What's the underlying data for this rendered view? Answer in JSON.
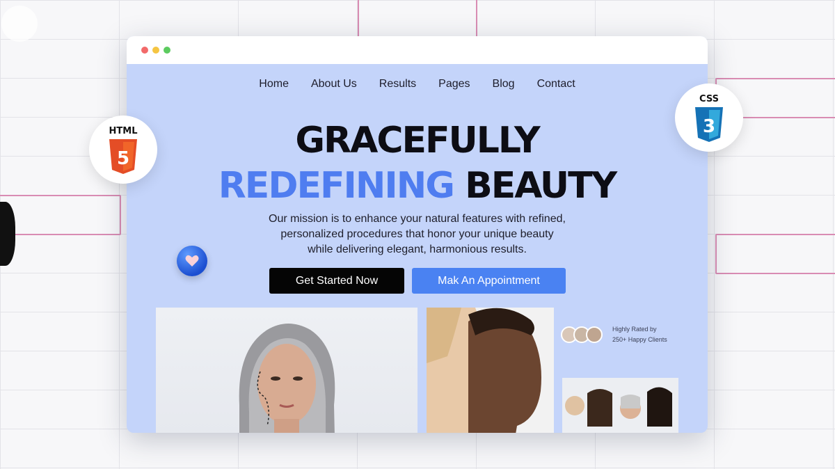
{
  "nav": {
    "items": [
      {
        "label": "Home"
      },
      {
        "label": "About Us"
      },
      {
        "label": "Results"
      },
      {
        "label": "Pages"
      },
      {
        "label": "Blog"
      },
      {
        "label": "Contact"
      }
    ]
  },
  "hero": {
    "line1": "GRACEFULLY",
    "line2_accent": "REDEFINING",
    "line2_rest": "BEAUTY",
    "subtitle_lines": [
      "Our mission is to enhance your natural features with refined,",
      "personalized procedures that honor your unique beauty",
      "while delivering elegant, harmonious results."
    ],
    "primary_button": "Get Started Now",
    "secondary_button": "Mak An Appointment"
  },
  "rating": {
    "line1": "Highly Rated by",
    "line2": "250+ Happy Clients"
  },
  "badges": {
    "html": "HTML",
    "html_number": "5",
    "css": "CSS",
    "css_number": "3"
  },
  "colors": {
    "accent": "#4f7df0",
    "hero_bg": "#c4d4fa",
    "button_primary": "#050505",
    "button_secondary": "#4a82f2"
  },
  "icons": [
    "html5-icon",
    "css3-icon",
    "heart-icon"
  ]
}
